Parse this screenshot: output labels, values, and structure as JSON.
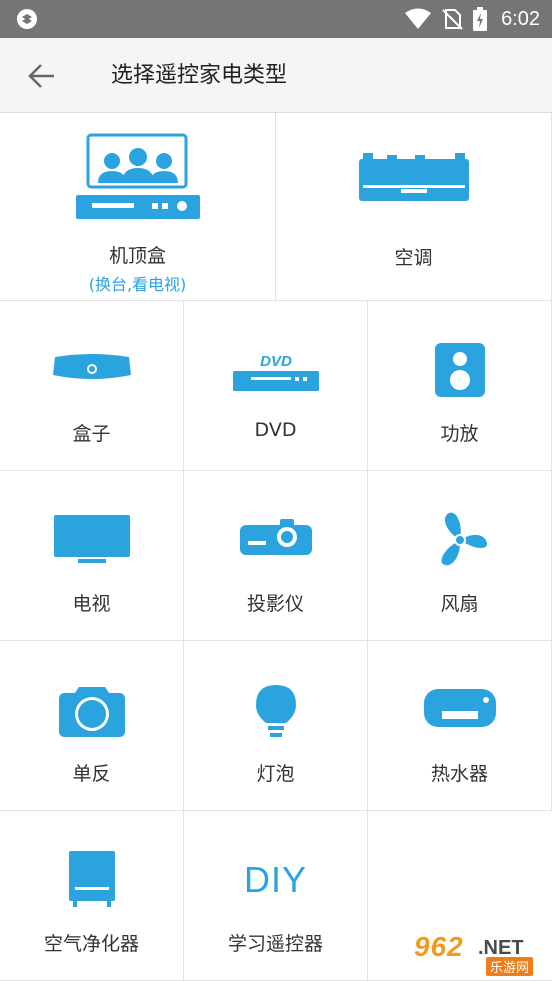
{
  "status_bar": {
    "time": "6:02",
    "icons": [
      "app-logo-icon",
      "wifi-icon",
      "no-sim-icon",
      "battery-charging-icon"
    ]
  },
  "app_bar": {
    "back_icon": "arrow-left-icon",
    "title": "选择遥控家电类型"
  },
  "devices": {
    "settop": {
      "label": "机顶盒",
      "sublabel": "(换台,看电视)"
    },
    "ac": {
      "label": "空调"
    },
    "box": {
      "label": "盒子"
    },
    "dvd": {
      "label": "DVD",
      "icon_text": "DVD"
    },
    "amp": {
      "label": "功放"
    },
    "tv": {
      "label": "电视"
    },
    "projector": {
      "label": "投影仪"
    },
    "fan": {
      "label": "风扇"
    },
    "camera": {
      "label": "单反"
    },
    "bulb": {
      "label": "灯泡"
    },
    "heater": {
      "label": "热水器"
    },
    "purifier": {
      "label": "空气净化器"
    },
    "diy": {
      "label": "学习遥控器",
      "icon_text": "DIY"
    }
  },
  "watermark": {
    "brand": "962",
    "suffix": ".NET",
    "site": "乐游网"
  },
  "colors": {
    "accent": "#2aa3df",
    "status_bar": "#757575",
    "app_bar": "#f5f5f5",
    "divider": "#e2e2e2"
  }
}
